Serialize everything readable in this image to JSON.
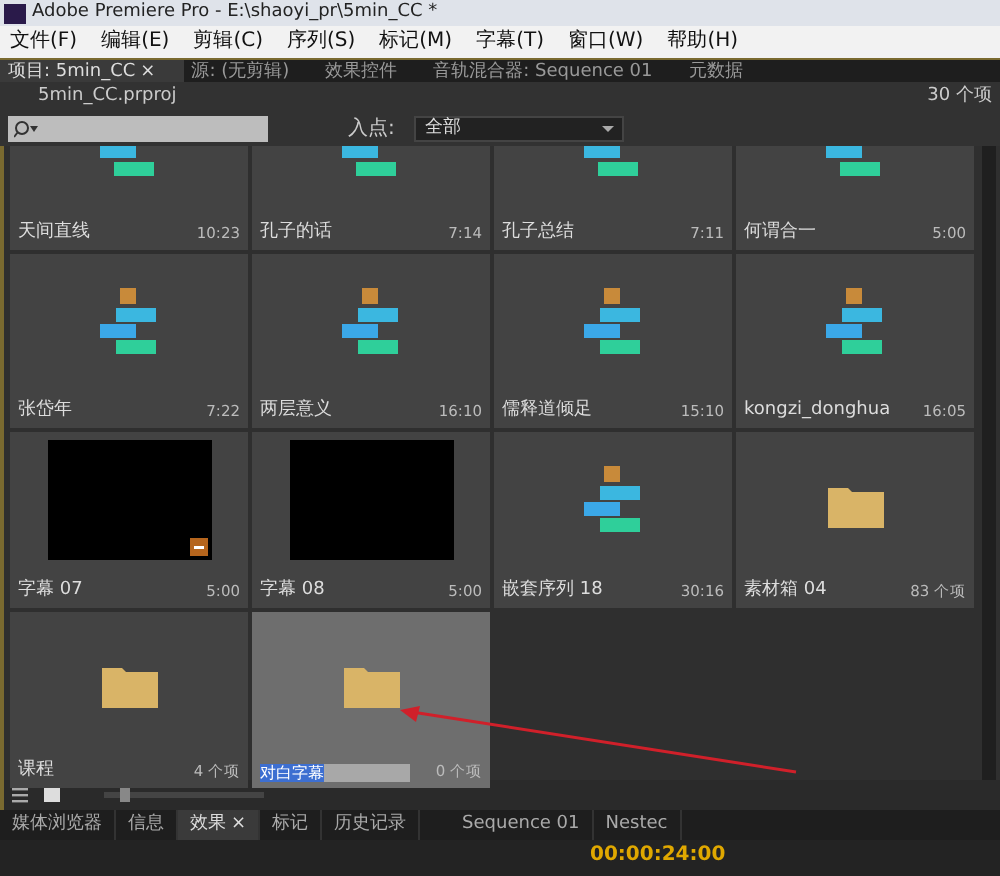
{
  "window": {
    "title": "Adobe Premiere Pro - E:\\shaoyi_pr\\5min_CC *"
  },
  "menu": [
    "文件(F)",
    "编辑(E)",
    "剪辑(C)",
    "序列(S)",
    "标记(M)",
    "字幕(T)",
    "窗口(W)",
    "帮助(H)"
  ],
  "panel_tabs": [
    {
      "label": "项目: 5min_CC",
      "selected": true,
      "close": "×"
    },
    {
      "label": "源: (无剪辑)",
      "selected": false
    },
    {
      "label": "效果控件",
      "selected": false
    },
    {
      "label": "音轨混合器: Sequence 01",
      "selected": false
    },
    {
      "label": "元数据",
      "selected": false
    }
  ],
  "project": {
    "file": "5min_CC.prproj",
    "count": "30 个项",
    "in_point_label": "入点:",
    "in_point_value": "全部"
  },
  "items": [
    {
      "kind": "sequence",
      "name": "天间直线",
      "info": "10:23",
      "selected": false,
      "cut": true
    },
    {
      "kind": "sequence",
      "name": "孔子的话",
      "info": "7:14",
      "selected": false,
      "cut": true
    },
    {
      "kind": "sequence",
      "name": "孔子总结",
      "info": "7:11",
      "selected": false,
      "cut": true
    },
    {
      "kind": "sequence",
      "name": "何谓合一",
      "info": "5:00",
      "selected": false,
      "cut": true
    },
    {
      "kind": "sequence",
      "name": "张岱年",
      "info": "7:22",
      "selected": false,
      "cut": false
    },
    {
      "kind": "sequence",
      "name": "两层意义",
      "info": "16:10",
      "selected": false,
      "cut": false
    },
    {
      "kind": "sequence",
      "name": "儒释道倾足",
      "info": "15:10",
      "selected": false,
      "cut": false
    },
    {
      "kind": "sequence",
      "name": "kongzi_donghua",
      "info": "16:05",
      "selected": false,
      "cut": false
    },
    {
      "kind": "title",
      "name": "字幕 07",
      "info": "5:00",
      "selected": false,
      "cut": false
    },
    {
      "kind": "title",
      "name": "字幕 08",
      "info": "5:00",
      "selected": false,
      "cut": false
    },
    {
      "kind": "sequence",
      "name": "嵌套序列 18",
      "info": "30:16",
      "selected": false,
      "cut": false
    },
    {
      "kind": "folder",
      "name": "素材箱 04",
      "info": "83 个项",
      "selected": false,
      "cut": false
    },
    {
      "kind": "folder",
      "name": "课程",
      "info": "4 个项",
      "selected": false,
      "cut": false
    },
    {
      "kind": "folder",
      "name": "对白字幕",
      "info": "0 个项",
      "selected": true,
      "cut": false
    }
  ],
  "bottom_tabs": [
    {
      "label": "媒体浏览器",
      "selected": false
    },
    {
      "label": "信息",
      "selected": false
    },
    {
      "label": "效果",
      "selected": true,
      "close": "×"
    },
    {
      "label": "标记",
      "selected": false
    },
    {
      "label": "历史记录",
      "selected": false
    }
  ],
  "timeline_tabs": [
    "Sequence 01",
    "Nestec"
  ],
  "timecode": "00:00:24:00",
  "zoom_slider": {
    "level": 0.1
  }
}
